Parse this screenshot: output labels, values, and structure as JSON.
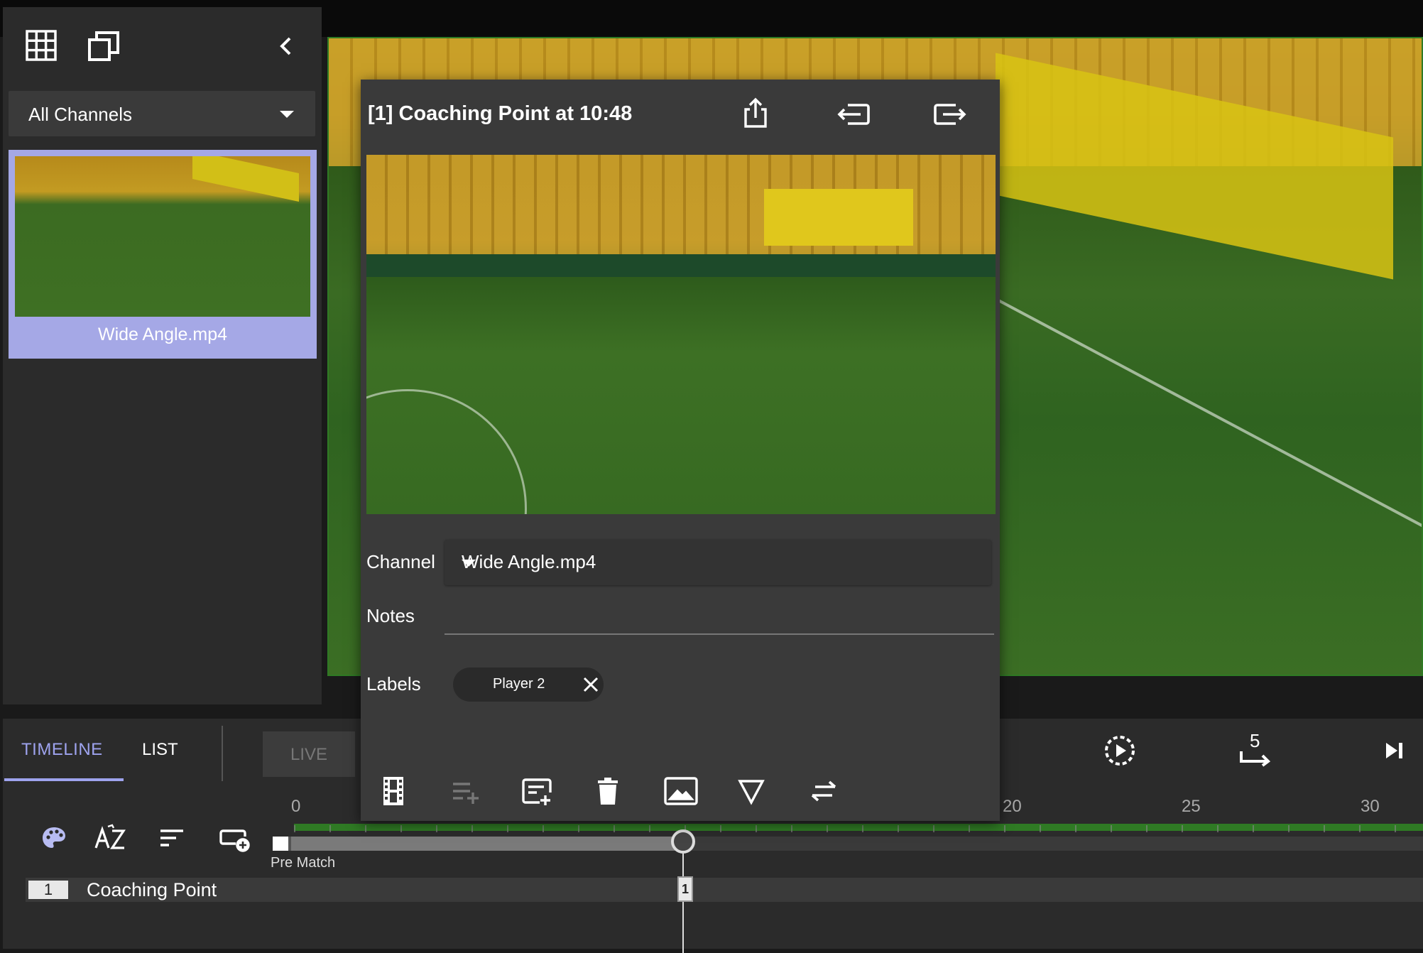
{
  "sidebar": {
    "channel_filter": "All Channels",
    "clips": [
      {
        "label": "Wide Angle.mp4"
      }
    ]
  },
  "popup": {
    "title": "[1] Coaching Point at 10:48",
    "channel_label": "Channel",
    "channel_value": "Wide Angle.mp4",
    "notes_label": "Notes",
    "notes_value": "",
    "labels_label": "Labels",
    "labels": [
      "Player 2"
    ]
  },
  "timeline": {
    "tabs": [
      {
        "label": "TIMELINE",
        "active": true
      },
      {
        "label": "LIST",
        "active": false
      }
    ],
    "live_label": "LIVE",
    "skip_seconds": "5",
    "ticks": [
      "0",
      "20",
      "25",
      "30"
    ],
    "period_label": "Pre Match",
    "rows": [
      {
        "number": "1",
        "name": "Coaching Point"
      }
    ],
    "marker_number": "1"
  },
  "colors": {
    "accent": "#9ea3ee",
    "selected_clip": "#a5a8e6",
    "ruler": "#2f7a24"
  }
}
